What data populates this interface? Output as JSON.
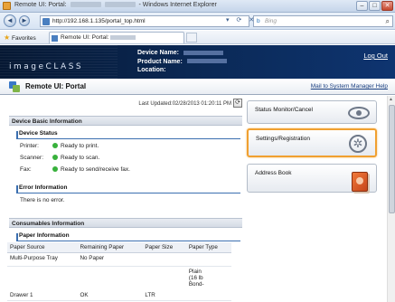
{
  "window": {
    "title_prefix": "Remote UI: Portal:",
    "title_suffix": "- Windows Internet Explorer",
    "minimize": "–",
    "maximize": "□",
    "close": "✕"
  },
  "addressbar": {
    "back": "◄",
    "forward": "►",
    "url": "http://192.168.1.135/portal_top.html",
    "url_icons": "▾ ⟳ ✕",
    "search_engine": "b",
    "search_placeholder": "Bing",
    "search_icon": "⌕"
  },
  "favorites": {
    "label": "Favorites",
    "tab_title": "Remote UI: Portal:"
  },
  "banner": {
    "logo": "imageCLASS",
    "device_name_label": "Device Name:",
    "product_name_label": "Product Name:",
    "location_label": "Location:",
    "logout": "Log Out"
  },
  "portal": {
    "title": "Remote UI: Portal",
    "mail_link": "Mail to System Manager Help"
  },
  "main": {
    "last_updated": "Last Updated:02/28/2013 01:20:11 PM",
    "refresh_icon": "⟳",
    "basic_info_header": "Device Basic Information",
    "device_status_header": "Device Status",
    "status": [
      {
        "label": "Printer:",
        "value": "Ready to print."
      },
      {
        "label": "Scanner:",
        "value": "Ready to scan."
      },
      {
        "label": "Fax:",
        "value": "Ready to send/receive fax."
      }
    ],
    "error_header": "Error Information",
    "error_text": "There is no error.",
    "consumables_header": "Consumables Information",
    "paper_header": "Paper Information",
    "paper_columns": [
      "Paper Source",
      "Remaining Paper",
      "Paper Size",
      "Paper Type"
    ],
    "paper_rows": [
      {
        "source": "Multi-Purpose Tray",
        "remaining": "No Paper",
        "size": "",
        "type": ""
      },
      {
        "source": "Drawer 1",
        "remaining": "OK",
        "size": "LTR",
        "type_lines": [
          "Plain",
          "(16 lb",
          "Bond-"
        ]
      }
    ]
  },
  "cards": {
    "status_monitor": "Status Monitor/Cancel",
    "settings": "Settings/Registration",
    "address_book": "Address Book"
  },
  "colors": {
    "banner": "#0b2a58",
    "highlight": "#f0a030",
    "status_ok": "#38b13c",
    "link": "#1a3f80"
  }
}
